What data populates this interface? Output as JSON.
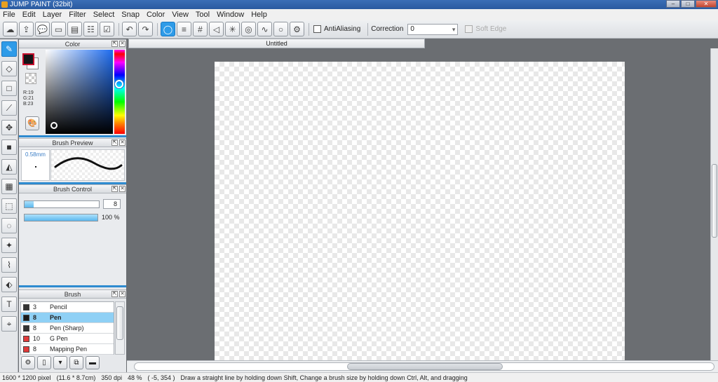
{
  "window": {
    "title": "JUMP PAINT (32bit)"
  },
  "menu": [
    "File",
    "Edit",
    "Layer",
    "Filter",
    "Select",
    "Snap",
    "Color",
    "View",
    "Tool",
    "Window",
    "Help"
  ],
  "toolbar": {
    "antialiasing_label": "AntiAliasing",
    "correction_label": "Correction",
    "correction_value": "0",
    "soft_edge_label": "Soft Edge"
  },
  "panels": {
    "color": {
      "title": "Color",
      "r": "R:19",
      "g": "G:21",
      "b": "B:23",
      "fg_color": "#131517"
    },
    "brush_preview": {
      "title": "Brush Preview",
      "size": "0.58mm"
    },
    "brush_control": {
      "title": "Brush Control",
      "size_value": "8",
      "opacity_value": "100 %",
      "size_level": 0.12,
      "opacity_level": 1.0
    },
    "brush": {
      "title": "Brush",
      "items": [
        {
          "size": "3",
          "name": "Pencil",
          "color": "#333333"
        },
        {
          "size": "8",
          "name": "Pen",
          "color": "#1a1a1a",
          "selected": true
        },
        {
          "size": "8",
          "name": "Pen (Sharp)",
          "color": "#333333"
        },
        {
          "size": "10",
          "name": "G Pen",
          "color": "#e03a3a"
        },
        {
          "size": "8",
          "name": "Mapping Pen",
          "color": "#e03a3a"
        }
      ]
    }
  },
  "document": {
    "tab_title": "Untitled"
  },
  "status": {
    "pixel_size": "1600 * 1200 pixel",
    "physical_size": "(11.6 * 8.7cm)",
    "dpi": "350 dpi",
    "zoom": "48 %",
    "cursor": "( -5, 354 )",
    "hint": "Draw a straight line by holding down Shift, Change a brush size by holding down Ctrl, Alt, and dragging"
  }
}
